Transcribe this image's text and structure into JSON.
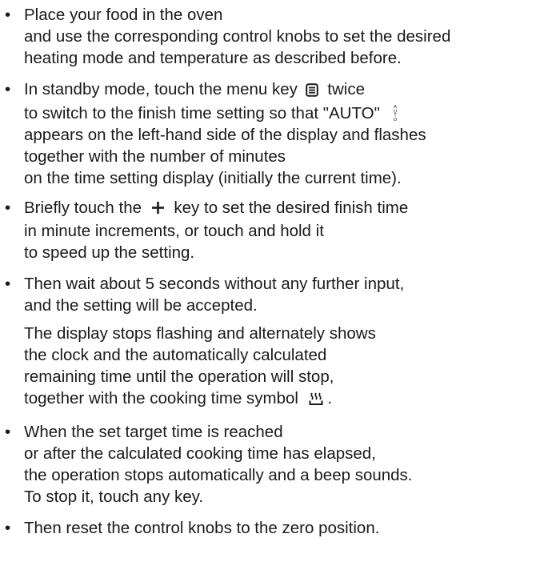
{
  "items": [
    {
      "lines": [
        "Place your food in the oven",
        "and use the corresponding control knobs to set the desired",
        "heating mode and temperature as described before."
      ]
    },
    {
      "l1a": "In standby mode, touch  the menu key",
      "l1b": "twice",
      "l2a": "to switch to the finish time setting so that \"AUTO\"",
      "l3": "appears on the left-hand side of the display and flashes",
      "l4": "together with the number of minutes",
      "l5": "on the time setting display (initially the current time)."
    },
    {
      "l1a": "Briefly touch the",
      "l1b": "key to set the desired finish time",
      "l2": "in minute increments, or touch and hold it",
      "l3": "to speed up the setting."
    },
    {
      "l1": "Then wait about 5 seconds without any further input,",
      "l2": "and the setting will be accepted.",
      "p2": [
        "The display stops flashing and alternately shows",
        "the clock and the automatically calculated",
        "remaining time until the operation will stop,"
      ],
      "p2last": "together with the cooking time symbol",
      "p2end": "."
    },
    {
      "lines": [
        "When the set target time is reached",
        "or after the calculated cooking time has elapsed,",
        "the operation stops automatically and a beep sounds.",
        "To stop it, touch any key."
      ]
    },
    {
      "lines": [
        "Then reset the control knobs to the zero position."
      ]
    }
  ],
  "bullet": "•",
  "auto_icon_letters": [
    "A",
    "U",
    "T",
    "O"
  ],
  "icons": {
    "menu": "menu-key-icon",
    "auto": "auto-indicator-icon",
    "plus": "plus-key-icon",
    "cooking": "cooking-time-icon"
  }
}
